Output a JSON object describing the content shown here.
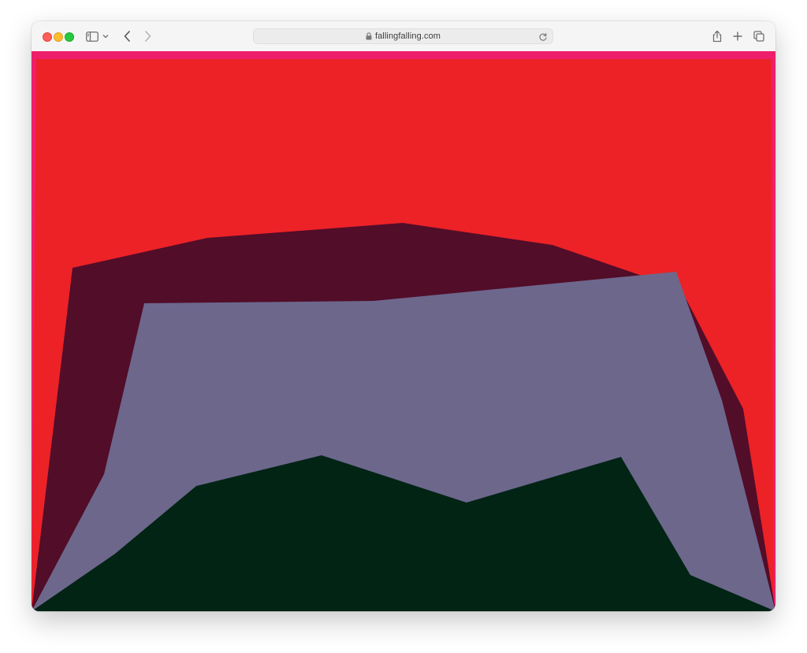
{
  "browser": {
    "url": "fallingfalling.com",
    "toolbar_icons": [
      "sidebar-icon",
      "chevron-down-icon",
      "back-icon",
      "forward-icon",
      "lock-icon",
      "reload-icon",
      "share-icon",
      "new-tab-icon",
      "tabs-overview-icon"
    ]
  },
  "page": {
    "colors": {
      "frame_pink": "#ee1f6a",
      "background_red": "#ec2227",
      "dark_maroon": "#520d29",
      "slate_purple": "#6d678c",
      "dark_green": "#022415"
    }
  }
}
